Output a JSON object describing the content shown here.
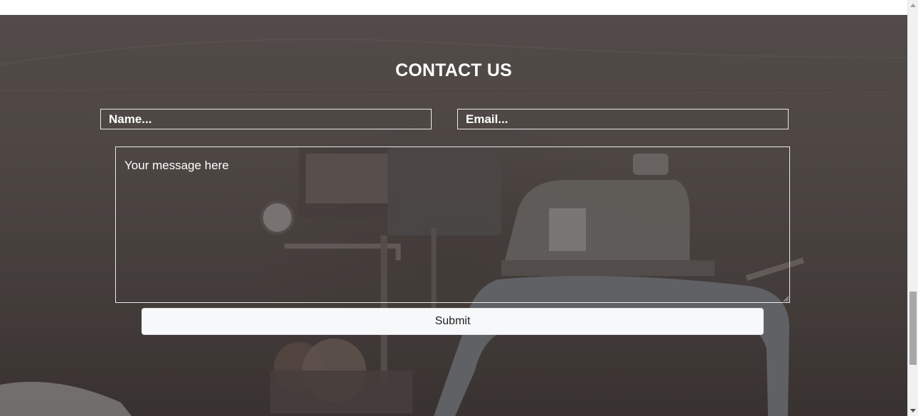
{
  "section": {
    "title": "CONTACT US"
  },
  "form": {
    "name_placeholder": "Name...",
    "email_placeholder": "Email...",
    "message_placeholder": "Your message here",
    "submit_label": "Submit"
  }
}
